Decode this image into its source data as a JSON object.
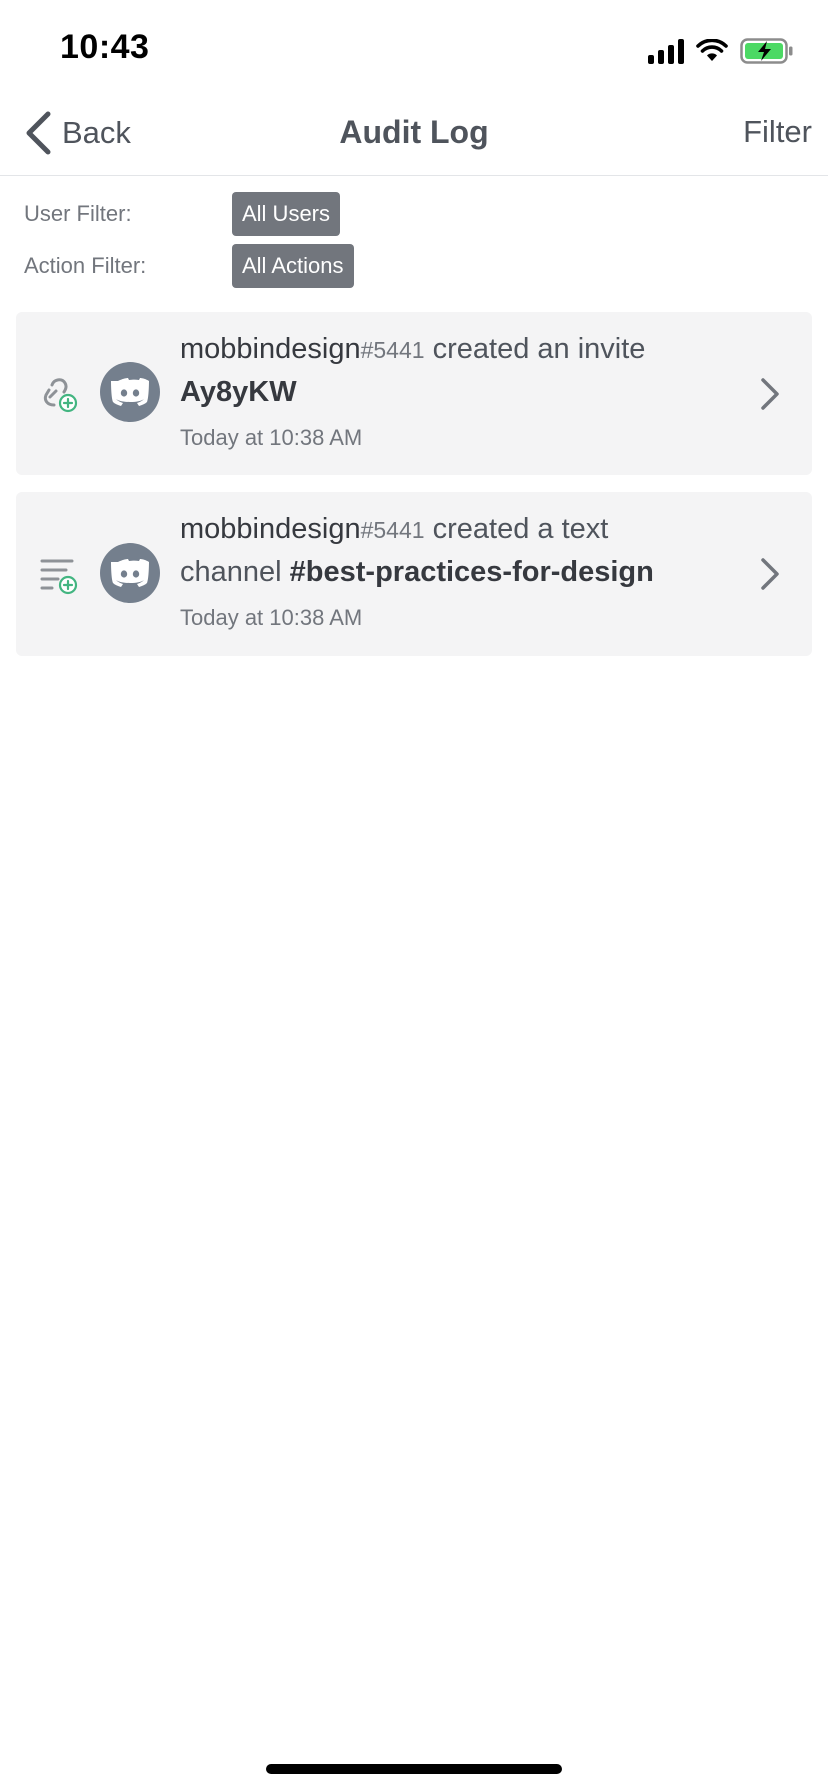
{
  "status_bar": {
    "time": "10:43"
  },
  "nav": {
    "back_label": "Back",
    "title": "Audit Log",
    "filter_label": "Filter"
  },
  "filters": {
    "user_label": "User Filter:",
    "user_value": "All Users",
    "action_label": "Action Filter:",
    "action_value": "All Actions"
  },
  "entries": [
    {
      "action_icon": "invite-create-icon",
      "username": "mobbindesign",
      "discriminator": "#5441",
      "action_text": " created an invite",
      "line2_prefix": "",
      "target": "Ay8yKW",
      "timestamp": "Today at 10:38 AM"
    },
    {
      "action_icon": "channel-create-icon",
      "username": "mobbindesign",
      "discriminator": "#5441",
      "action_text": " created a text",
      "line2_prefix": "channel ",
      "target": "#best-practices-for-design",
      "timestamp": "Today at 10:38 AM"
    }
  ],
  "colors": {
    "accent_green": "#43b581",
    "chip_bg": "#72767d",
    "row_bg": "#f4f4f5",
    "battery_fill": "#4cd964"
  }
}
